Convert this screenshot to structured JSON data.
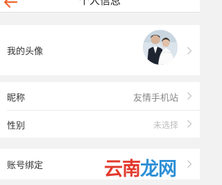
{
  "header": {
    "title": "个人信息",
    "back_icon": "back-arrow-icon",
    "back_color": "#f0652e"
  },
  "profile": {
    "avatar_label": "我的头像",
    "nickname_label": "昵称",
    "nickname_value": "友情手机站",
    "gender_label": "性别",
    "gender_value": "未选择",
    "account_binding_label": "账号绑定"
  },
  "watermark": {
    "part1": "云南",
    "part2": "龙网"
  },
  "colors": {
    "background": "#f2f2f2",
    "row": "#ffffff",
    "chevron": "#c8c8c8",
    "placeholder": "#bdbdbd"
  }
}
